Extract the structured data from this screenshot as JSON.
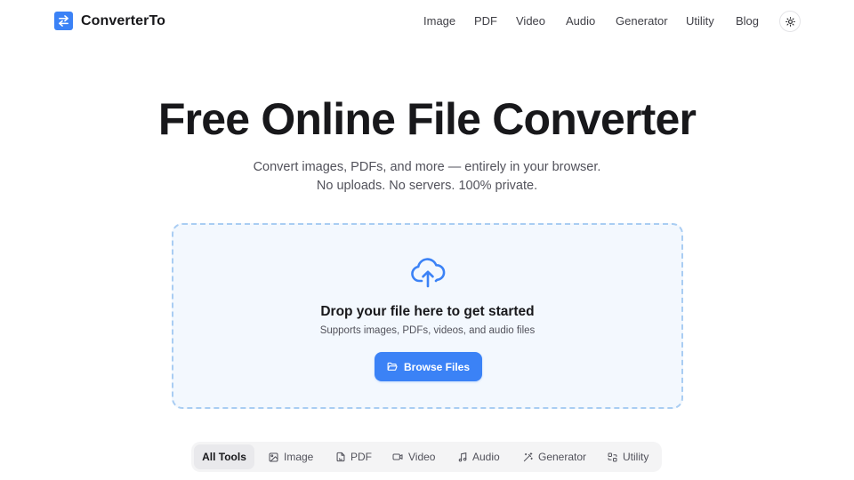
{
  "header": {
    "brand_name": "ConverterTo",
    "nav": [
      "Image",
      "PDF",
      "Video",
      "Audio",
      "Generator",
      "Utility",
      "Blog"
    ],
    "theme_icon": "sun-icon"
  },
  "hero": {
    "title": "Free Online File Converter",
    "subtitle_line1": "Convert images, PDFs, and more — entirely in your browser.",
    "subtitle_line2": "No uploads. No servers. 100% private."
  },
  "dropzone": {
    "icon": "cloud-upload-icon",
    "title": "Drop your file here to get started",
    "subtitle": "Supports images, PDFs, videos, and audio files",
    "button_label": "Browse Files",
    "button_icon": "folder-open-icon"
  },
  "tabs": [
    {
      "label": "All Tools",
      "icon": "",
      "active": true
    },
    {
      "label": "Image",
      "icon": "image-icon",
      "active": false
    },
    {
      "label": "PDF",
      "icon": "file-pdf-icon",
      "active": false
    },
    {
      "label": "Video",
      "icon": "video-icon",
      "active": false
    },
    {
      "label": "Audio",
      "icon": "music-icon",
      "active": false
    },
    {
      "label": "Generator",
      "icon": "wand-icon",
      "active": false
    },
    {
      "label": "Utility",
      "icon": "utility-icon",
      "active": false
    }
  ],
  "colors": {
    "accent": "#3b82f6",
    "dropzone_bg": "#f3f8fe",
    "dropzone_border": "#a9cdf3",
    "text_primary": "#18181b",
    "text_muted": "#52525b"
  }
}
